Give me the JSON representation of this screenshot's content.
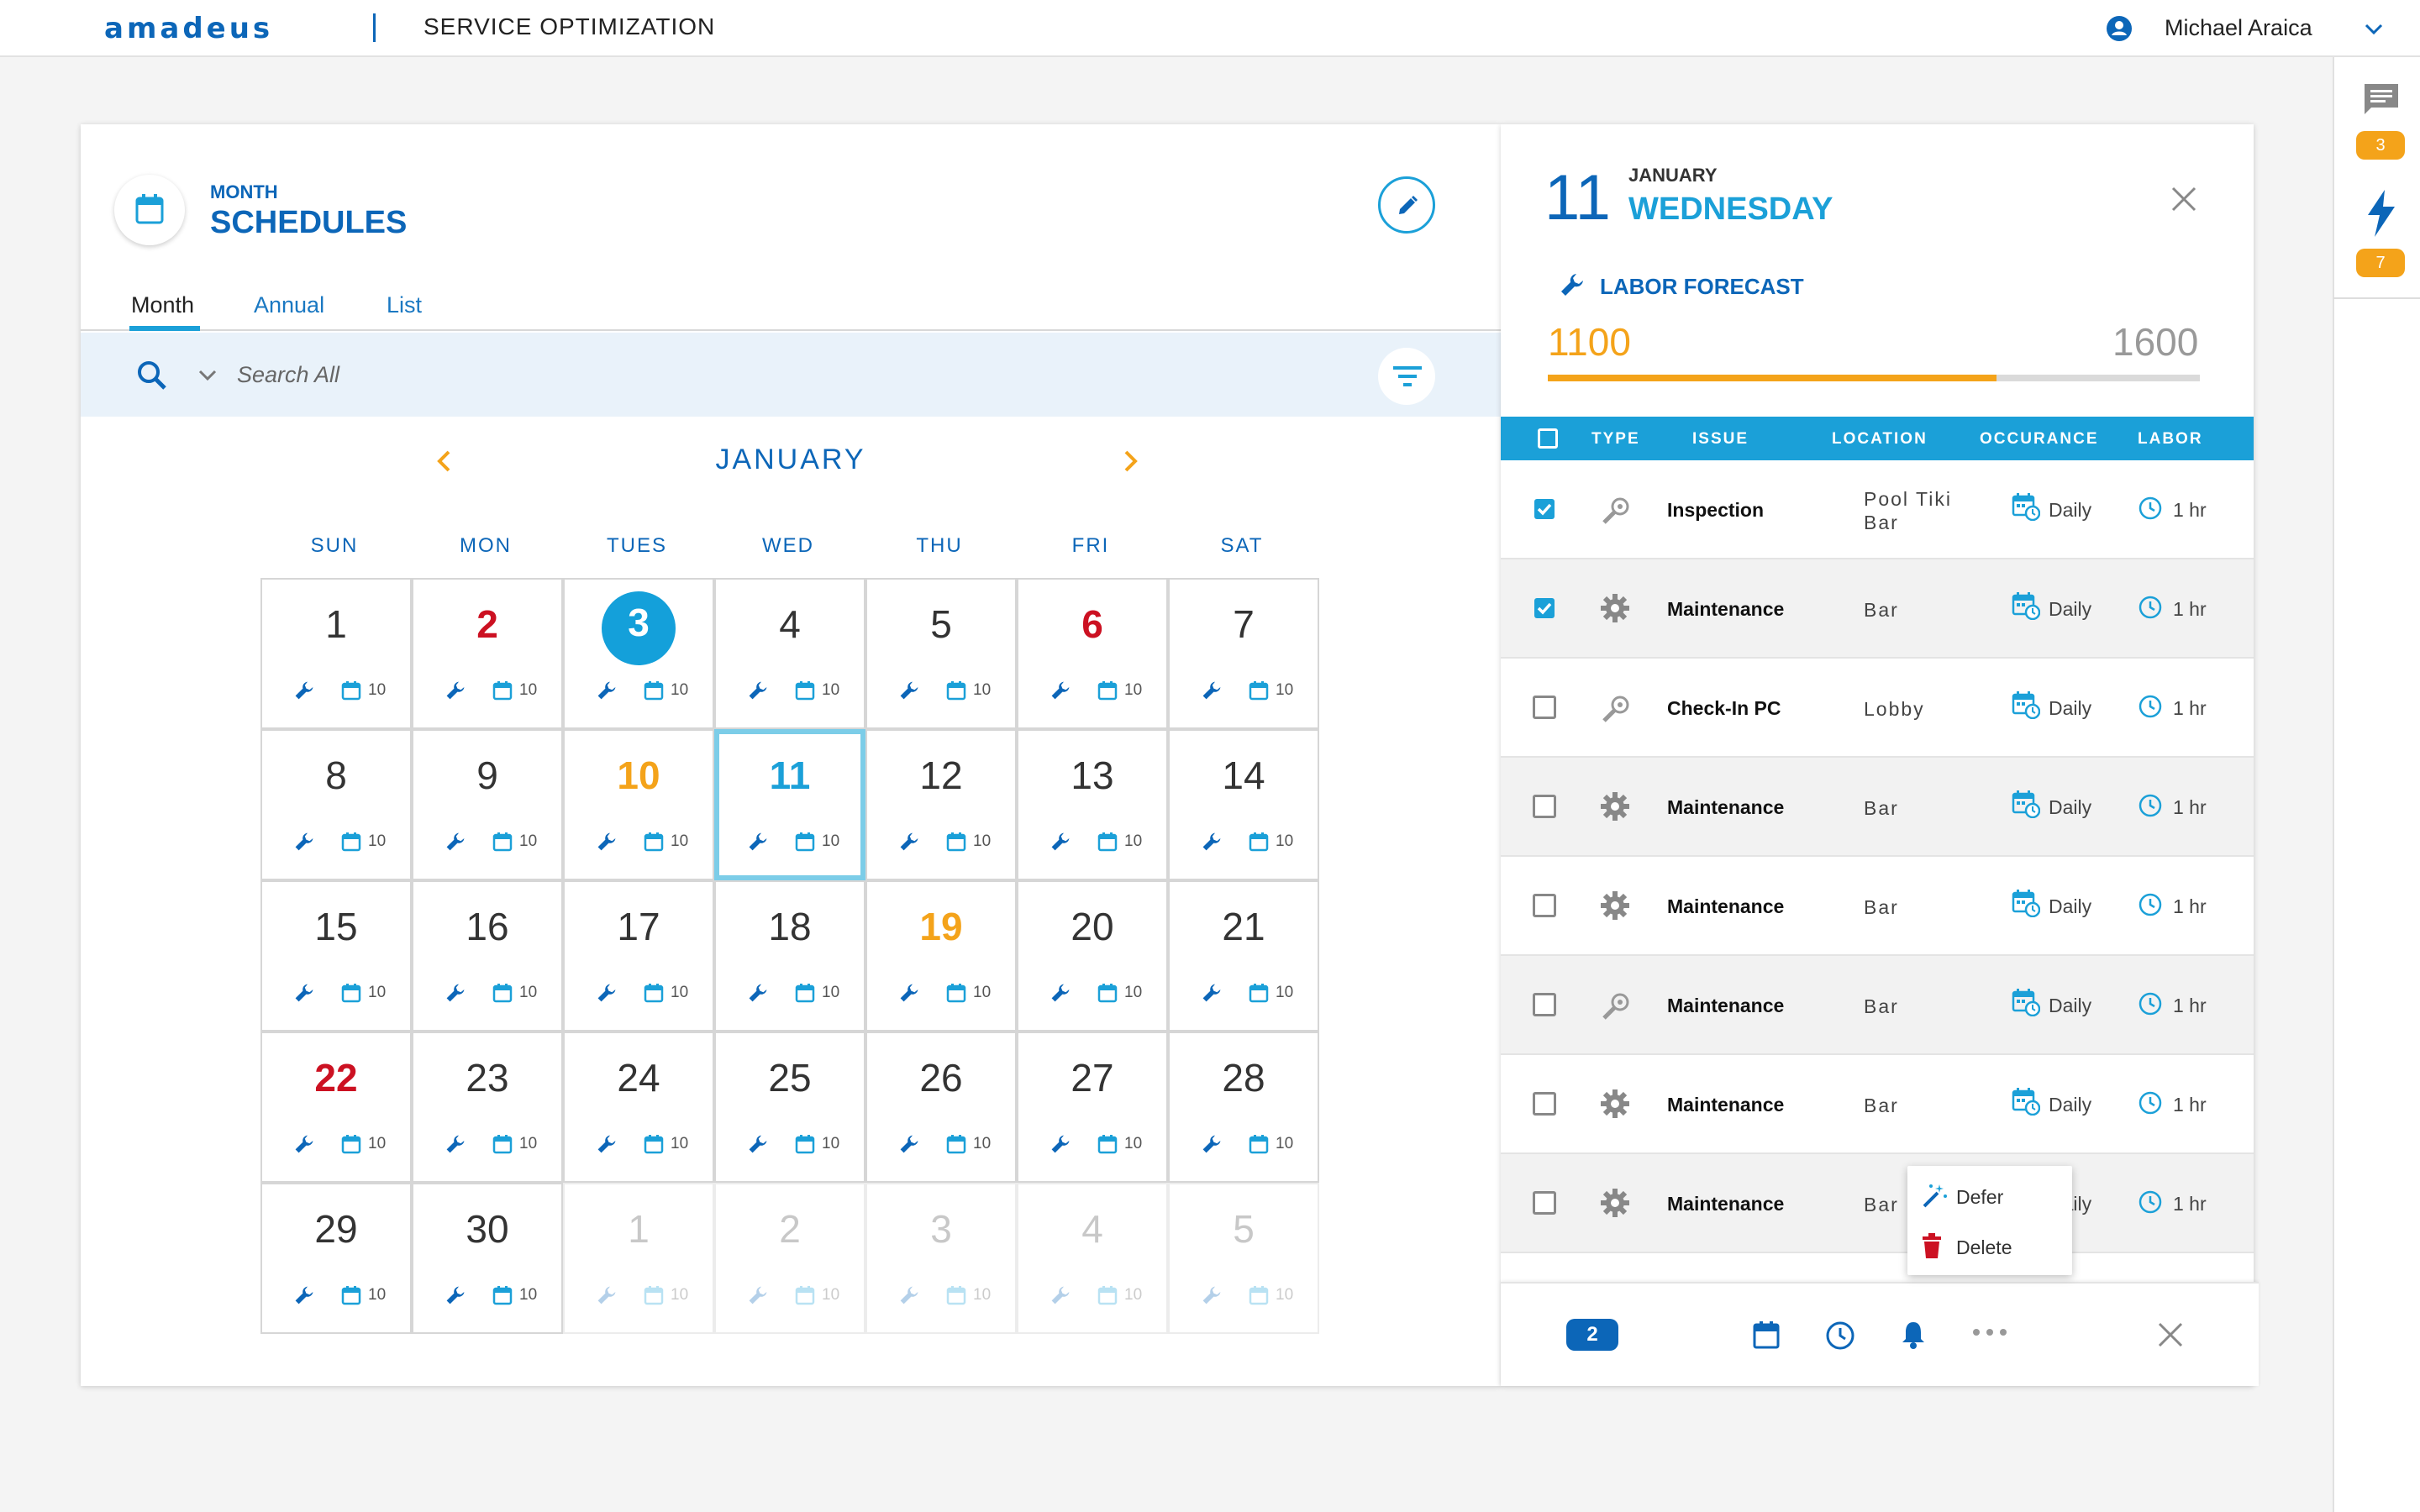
{
  "header": {
    "logo": "amadeus",
    "app_title": "SERVICE OPTIMIZATION",
    "user_name": "Michael Araica"
  },
  "rail": {
    "messages_count": "3",
    "alerts_count": "7"
  },
  "schedule": {
    "subtitle": "MONTH",
    "title": "SCHEDULES",
    "tabs": [
      "Month",
      "Annual",
      "List"
    ],
    "active_tab": "Month",
    "search": {
      "placeholder": "Search All"
    },
    "month": "JANUARY",
    "weekdays": [
      "SUN",
      "MON",
      "TUES",
      "WED",
      "THU",
      "FRI",
      "SAT"
    ],
    "days": [
      {
        "num": "1",
        "count": "10",
        "style": ""
      },
      {
        "num": "2",
        "count": "10",
        "style": "red"
      },
      {
        "num": "3",
        "count": "10",
        "style": "today"
      },
      {
        "num": "4",
        "count": "10",
        "style": ""
      },
      {
        "num": "5",
        "count": "10",
        "style": ""
      },
      {
        "num": "6",
        "count": "10",
        "style": "red"
      },
      {
        "num": "7",
        "count": "10",
        "style": ""
      },
      {
        "num": "8",
        "count": "10",
        "style": ""
      },
      {
        "num": "9",
        "count": "10",
        "style": ""
      },
      {
        "num": "10",
        "count": "10",
        "style": "orange"
      },
      {
        "num": "11",
        "count": "10",
        "style": "selected"
      },
      {
        "num": "12",
        "count": "10",
        "style": ""
      },
      {
        "num": "13",
        "count": "10",
        "style": ""
      },
      {
        "num": "14",
        "count": "10",
        "style": ""
      },
      {
        "num": "15",
        "count": "10",
        "style": ""
      },
      {
        "num": "16",
        "count": "10",
        "style": ""
      },
      {
        "num": "17",
        "count": "10",
        "style": ""
      },
      {
        "num": "18",
        "count": "10",
        "style": ""
      },
      {
        "num": "19",
        "count": "10",
        "style": "orange"
      },
      {
        "num": "20",
        "count": "10",
        "style": ""
      },
      {
        "num": "21",
        "count": "10",
        "style": ""
      },
      {
        "num": "22",
        "count": "10",
        "style": "red"
      },
      {
        "num": "23",
        "count": "10",
        "style": ""
      },
      {
        "num": "24",
        "count": "10",
        "style": ""
      },
      {
        "num": "25",
        "count": "10",
        "style": ""
      },
      {
        "num": "26",
        "count": "10",
        "style": ""
      },
      {
        "num": "27",
        "count": "10",
        "style": ""
      },
      {
        "num": "28",
        "count": "10",
        "style": ""
      },
      {
        "num": "29",
        "count": "10",
        "style": ""
      },
      {
        "num": "30",
        "count": "10",
        "style": ""
      },
      {
        "num": "1",
        "count": "10",
        "style": "dim"
      },
      {
        "num": "2",
        "count": "10",
        "style": "dim"
      },
      {
        "num": "3",
        "count": "10",
        "style": "dim"
      },
      {
        "num": "4",
        "count": "10",
        "style": "dim"
      },
      {
        "num": "5",
        "count": "10",
        "style": "dim"
      }
    ]
  },
  "detail": {
    "day": "11",
    "month": "JANUARY",
    "weekday": "WEDNESDAY",
    "labor_title": "LABOR FORECAST",
    "labor_current": "1100",
    "labor_max": "1600",
    "labor_fraction": 0.6875,
    "columns": [
      "TYPE",
      "ISSUE",
      "LOCATION",
      "OCCURANCE",
      "LABOR"
    ],
    "rows": [
      {
        "checked": true,
        "type": "inspect",
        "issue": "Inspection",
        "location": "Pool Tiki Bar",
        "occurrence": "Daily",
        "labor": "1 hr"
      },
      {
        "checked": true,
        "type": "gear",
        "issue": "Maintenance",
        "location": "Bar",
        "occurrence": "Daily",
        "labor": "1 hr"
      },
      {
        "checked": false,
        "type": "inspect",
        "issue": "Check-In PC",
        "location": "Lobby",
        "occurrence": "Daily",
        "labor": "1 hr"
      },
      {
        "checked": false,
        "type": "gear",
        "issue": "Maintenance",
        "location": "Bar",
        "occurrence": "Daily",
        "labor": "1 hr"
      },
      {
        "checked": false,
        "type": "gear",
        "issue": "Maintenance",
        "location": "Bar",
        "occurrence": "Daily",
        "labor": "1 hr"
      },
      {
        "checked": false,
        "type": "inspect",
        "issue": "Maintenance",
        "location": "Bar",
        "occurrence": "Daily",
        "labor": "1 hr"
      },
      {
        "checked": false,
        "type": "gear",
        "issue": "Maintenance",
        "location": "Bar",
        "occurrence": "Daily",
        "labor": "1 hr"
      },
      {
        "checked": false,
        "type": "gear",
        "issue": "Maintenance",
        "location": "Bar",
        "occurrence": "Daily",
        "labor": "1 hr"
      }
    ],
    "context_menu": [
      "Defer",
      "Delete"
    ],
    "selected_count": "2"
  },
  "colors": {
    "brand": "#0c66b8",
    "accent": "#1ba0d8",
    "orange": "#f4a31a",
    "red": "#cc1122"
  }
}
